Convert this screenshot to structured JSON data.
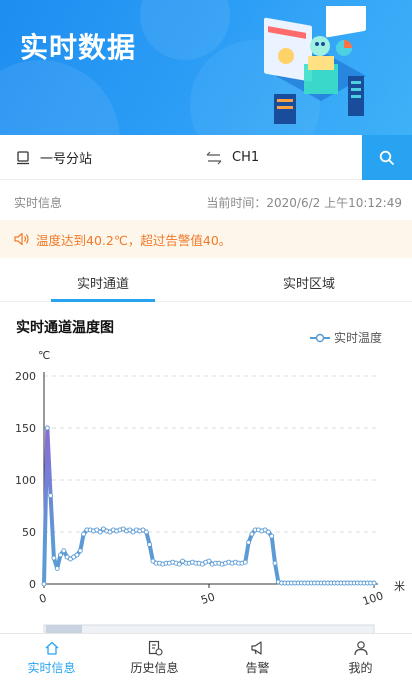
{
  "header": {
    "title": "实时数据"
  },
  "selector": {
    "station": "一号分站",
    "channel": "CH1"
  },
  "info": {
    "left": "实时信息",
    "time_label": "当前时间：",
    "time_value": "2020/6/2 上午10:12:49"
  },
  "alert": {
    "text": "温度达到40.2℃，超过告警值40。",
    "color": "#f07a2a"
  },
  "tabs": [
    {
      "label": "实时通道",
      "active": true
    },
    {
      "label": "实时区域",
      "active": false
    }
  ],
  "chart_data": {
    "type": "line",
    "title": "实时通道温度图",
    "ylabel": "℃",
    "xlabel": "米",
    "ylim": [
      0,
      200
    ],
    "xlim": [
      0,
      100
    ],
    "yticks": [
      0,
      50,
      100,
      150,
      200
    ],
    "xticks": [
      0,
      50,
      100
    ],
    "legend_position": "top-right",
    "grid": true,
    "series": [
      {
        "name": "实时温度",
        "color": "#5b9bd5",
        "x": [
          0,
          1,
          2,
          3,
          4,
          5,
          6,
          7,
          8,
          9,
          10,
          11,
          12,
          13,
          14,
          15,
          16,
          17,
          18,
          19,
          20,
          21,
          22,
          23,
          24,
          25,
          26,
          27,
          28,
          29,
          30,
          31,
          32,
          33,
          34,
          35,
          36,
          37,
          38,
          39,
          40,
          41,
          42,
          43,
          44,
          45,
          46,
          47,
          48,
          49,
          50,
          51,
          52,
          53,
          54,
          55,
          56,
          57,
          58,
          59,
          60,
          61,
          62,
          63,
          64,
          65,
          66,
          67,
          68,
          69,
          70,
          71,
          72,
          73,
          74,
          75,
          76,
          77,
          78,
          79,
          80,
          81,
          82,
          83,
          84,
          85,
          86,
          87,
          88,
          89,
          90,
          91,
          92,
          93,
          94,
          95,
          96,
          97,
          98,
          99,
          100
        ],
        "y": [
          0,
          150,
          85,
          25,
          15,
          28,
          32,
          26,
          24,
          26,
          28,
          32,
          48,
          52,
          52,
          51,
          52,
          50,
          53,
          51,
          50,
          52,
          51,
          52,
          53,
          51,
          52,
          50,
          52,
          51,
          52,
          50,
          38,
          22,
          20,
          20,
          19,
          20,
          20,
          21,
          20,
          19,
          22,
          20,
          20,
          21,
          20,
          20,
          19,
          21,
          22,
          19,
          20,
          20,
          19,
          20,
          21,
          20,
          21,
          20,
          20,
          21,
          40,
          48,
          52,
          52,
          51,
          52,
          50,
          46,
          20,
          2,
          1,
          1,
          1,
          1,
          1,
          1,
          1,
          1,
          1,
          1,
          1,
          1,
          1,
          1,
          1,
          1,
          1,
          1,
          1,
          1,
          1,
          1,
          1,
          1,
          1,
          1,
          1,
          1,
          1
        ]
      }
    ]
  },
  "nav": [
    {
      "label": "实时信息",
      "icon": "home-icon",
      "active": true
    },
    {
      "label": "历史信息",
      "icon": "history-icon",
      "active": false
    },
    {
      "label": "告警",
      "icon": "alarm-icon",
      "active": false
    },
    {
      "label": "我的",
      "icon": "user-icon",
      "active": false
    }
  ],
  "colors": {
    "accent": "#27a3f2",
    "header_gradient_start": "#1d8ef0",
    "alert_bg": "#fdf6ea"
  }
}
